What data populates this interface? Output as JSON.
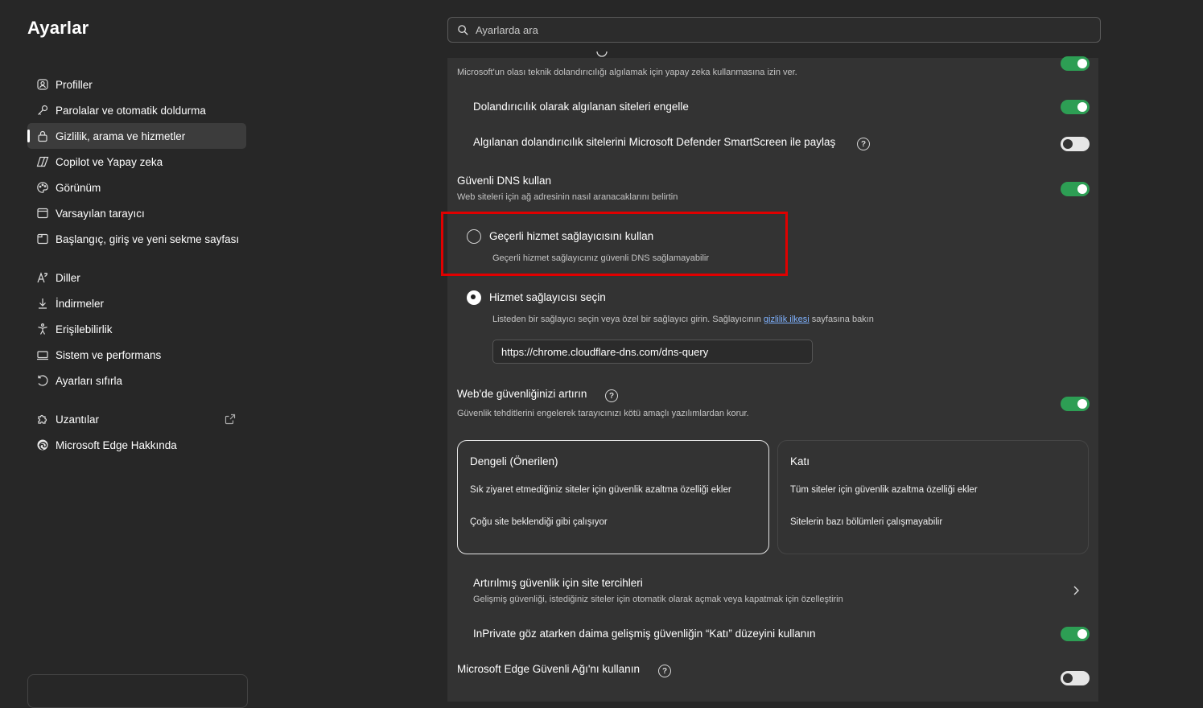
{
  "sidebar": {
    "title": "Ayarlar",
    "items": [
      {
        "label": "Profiller",
        "icon": "profile-icon"
      },
      {
        "label": "Parolalar ve otomatik doldurma",
        "icon": "key-icon"
      },
      {
        "label": "Gizlilik, arama ve hizmetler",
        "icon": "lock-icon",
        "active": true
      },
      {
        "label": "Copilot ve Yapay zeka",
        "icon": "copilot-icon"
      },
      {
        "label": "Görünüm",
        "icon": "palette-icon"
      },
      {
        "label": "Varsayılan tarayıcı",
        "icon": "browser-icon"
      },
      {
        "label": "Başlangıç, giriş ve yeni sekme sayfası",
        "icon": "home-tab-icon"
      },
      {
        "label": "Diller",
        "icon": "language-icon"
      },
      {
        "label": "İndirmeler",
        "icon": "download-icon"
      },
      {
        "label": "Erişilebilirlik",
        "icon": "accessibility-icon"
      },
      {
        "label": "Sistem ve performans",
        "icon": "laptop-icon"
      },
      {
        "label": "Ayarları sıfırla",
        "icon": "reset-icon"
      },
      {
        "label": "Uzantılar",
        "icon": "puzzle-icon"
      },
      {
        "label": "Microsoft Edge Hakkında",
        "icon": "edge-icon"
      }
    ]
  },
  "search": {
    "placeholder": "Ayarlarda ara"
  },
  "settings": {
    "ai_scam": {
      "desc": "Microsoft'un olası teknik dolandırıcılığı algılamak için yapay zeka kullanmasına izin ver.",
      "enabled": true
    },
    "block_scam": {
      "label": "Dolandırıcılık olarak algılanan siteleri engelle",
      "enabled": true
    },
    "share_scam": {
      "label": "Algılanan dolandırıcılık sitelerini Microsoft Defender SmartScreen ile paylaş",
      "enabled": false
    },
    "secure_dns": {
      "label": "Güvenli DNS kullan",
      "desc": "Web siteleri için ağ adresinin nasıl aranacaklarını belirtin",
      "enabled": true,
      "option_current": {
        "label": "Geçerli hizmet sağlayıcısını kullan",
        "desc": "Geçerli hizmet sağlayıcınız güvenli DNS sağlamayabilir",
        "selected": false
      },
      "option_choose": {
        "label": "Hizmet sağlayıcısı seçin",
        "desc_pre": "Listeden bir sağlayıcı seçin veya özel bir sağlayıcı girin. Sağlayıcının ",
        "desc_link": "gizlilik ilkesi",
        "desc_post": " sayfasına bakın",
        "selected": true,
        "url": "https://chrome.cloudflare-dns.com/dns-query"
      }
    },
    "web_security": {
      "label": "Web'de güvenliğinizi artırın",
      "desc": "Güvenlik tehditlerini engelerek tarayıcınızı kötü amaçlı yazılımlardan korur.",
      "enabled": true,
      "cards": [
        {
          "title": "Dengeli (Önerilen)",
          "line1": "Sık ziyaret etmediğiniz siteler için güvenlik azaltma özelliği ekler",
          "line2": "Çoğu site beklendiği gibi çalışıyor",
          "selected": true
        },
        {
          "title": "Katı",
          "line1": "Tüm siteler için güvenlik azaltma özelliği ekler",
          "line2": "Sitelerin bazı bölümleri çalışmayabilir",
          "selected": false
        }
      ]
    },
    "site_prefs": {
      "label": "Artırılmış güvenlik için site tercihleri",
      "desc": "Gelişmiş güvenliği, istediğiniz siteler için otomatik olarak açmak veya kapatmak için özelleştirin"
    },
    "inprivate_strict": {
      "label": "InPrivate göz atarken daima gelişmiş güvenliğin “Katı” düzeyini kullanın",
      "enabled": true
    },
    "secure_network": {
      "label": "Microsoft Edge Güvenli Ağı'nı kullanın",
      "enabled": false
    }
  },
  "help_glyph": "?",
  "colors": {
    "toggle_on": "#2d9e54",
    "highlight": "#e00000",
    "link": "#7fb2ff"
  }
}
